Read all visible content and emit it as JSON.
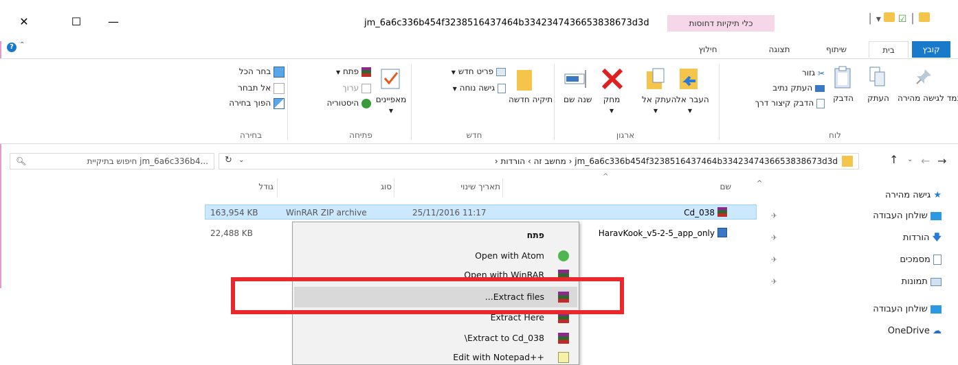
{
  "window": {
    "title": "jm_6a6c336b454f3238516437464b3342347436653838673d3d",
    "contextual_tab_group": "כלי תיקיות דחוסות",
    "controls": {
      "close": "✕",
      "maximize": "☐",
      "minimize": "—"
    }
  },
  "ribbon_tabs": {
    "file": "קובץ",
    "home": "בית",
    "share": "שיתוף",
    "view": "תצוגה",
    "extract": "חילוץ"
  },
  "ribbon": {
    "clipboard": {
      "label": "לוח",
      "pin": "הצמד לגישה מהירה",
      "copy": "העתק",
      "paste": "הדבק",
      "cut": "גזור",
      "copy_path": "העתק נתיב",
      "paste_shortcut": "הדבק קיצור דרך"
    },
    "organize": {
      "label": "ארגון",
      "move_to": "העבר אל",
      "copy_to": "העתק אל",
      "delete": "מחק",
      "rename": "שנה שם"
    },
    "new": {
      "label": "חדש",
      "new_folder": "תיקיה חדשה",
      "new_item": "פריט חדש",
      "easy_access": "גישה נוחה"
    },
    "open": {
      "label": "פתיחה",
      "properties": "מאפיינים",
      "open": "פתח",
      "edit": "ערוך",
      "history": "היסטוריה"
    },
    "select": {
      "label": "בחירה",
      "select_all": "בחר הכל",
      "select_none": "אל תבחר",
      "invert": "הפוך בחירה"
    }
  },
  "address": {
    "crumb_pc": "מחשב זה",
    "crumb_downloads": "הורדות",
    "crumb_folder": "jm_6a6c336b454f3238516437464b3342347436653838673d3d",
    "sep": "›",
    "search_placeholder": "חיפוש בתיקיית jm_6a6c336b4..."
  },
  "columns": {
    "name": "שם",
    "date": "תאריך שינוי",
    "type": "סוג",
    "size": "גודל"
  },
  "files": [
    {
      "name": "Cd_038",
      "date": "25/11/2016 11:17",
      "type": "WinRAR ZIP archive",
      "size": "163,954 KB"
    },
    {
      "name": "HaravKook_v5-2-5_app_only",
      "date": "",
      "type": "",
      "size": "22,488 KB"
    }
  ],
  "nav_pane": {
    "quick_access": "גישה מהירה",
    "desktop": "שולחן העבודה",
    "downloads": "הורדות",
    "documents": "מסמכים",
    "pictures": "תמונות",
    "desktop2": "שולחן העבודה",
    "onedrive": "OneDrive"
  },
  "context_menu": {
    "open": "פתח",
    "open_atom": "Open with Atom",
    "open_winrar": "Open with WinRAR",
    "extract_files": "...Extract files",
    "extract_here": "Extract Here",
    "extract_to": "\\Extract to Cd_038",
    "edit_notepad": "Edit with Notepad++"
  },
  "colors": {
    "accent_blue": "#1979ca",
    "selection": "#cce8ff",
    "context_tab": "#f6d7ea",
    "highlight_box": "#e8282d",
    "folder_yellow": "#f4c54a"
  }
}
